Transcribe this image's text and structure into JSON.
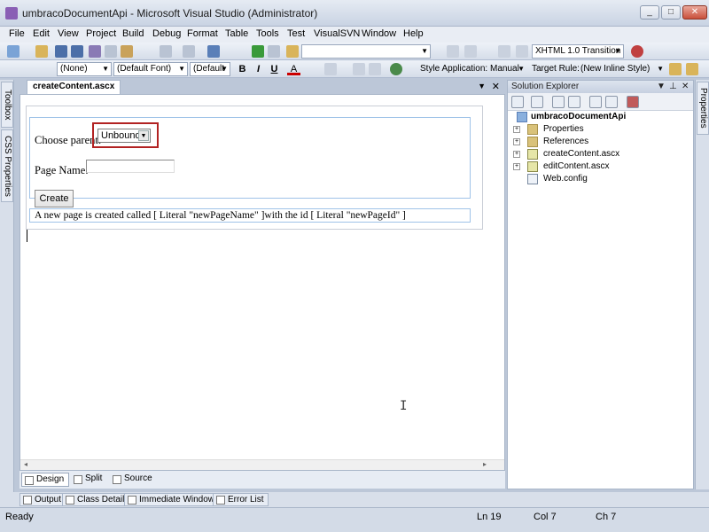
{
  "window": {
    "title": "umbracoDocumentApi - Microsoft Visual Studio (Administrator)"
  },
  "menu": [
    "File",
    "Edit",
    "View",
    "Project",
    "Build",
    "Debug",
    "Format",
    "Table",
    "Tools",
    "Test",
    "VisualSVN",
    "Window",
    "Help"
  ],
  "toolbar1": {
    "doctype": "XHTML 1.0 Transition"
  },
  "toolbar2": {
    "block_format": "(None)",
    "font": "(Default Font)",
    "size": "(Default",
    "bold": "B",
    "italic": "I",
    "underline": "U",
    "font_color": "A",
    "style_application_label": "Style Application:",
    "style_application_value": "Manual",
    "target_rule_label": "Target Rule:",
    "target_rule_value": "(New Inline Style)"
  },
  "left_strip": {
    "toolbox": "Toolbox",
    "css_properties": "CSS Properties"
  },
  "document": {
    "tab": "createContent.ascx",
    "choose_parent_label": "Choose parent:",
    "parent_select_value": "Unbound",
    "page_name_label": "Page Name:",
    "create_button": "Create",
    "result_text": "A new page is created called [ Literal \"newPageName\" ]with the id [ Literal \"newPageId\" ]"
  },
  "views": {
    "design": "Design",
    "split": "Split",
    "source": "Source"
  },
  "bottom_tabs": [
    "Output",
    "Class Details",
    "Immediate Window",
    "Error List"
  ],
  "status": {
    "text": "Ready",
    "line": "Ln 19",
    "col": "Col 7",
    "ch": "Ch 7"
  },
  "solution_explorer": {
    "title": "Solution Explorer",
    "project": "umbracoDocumentApi",
    "items": [
      "Properties",
      "References",
      "createContent.ascx",
      "editContent.ascx",
      "Web.config"
    ]
  },
  "right_strip": {
    "properties": "Properties"
  },
  "colors": {
    "highlight_box": "#b22222",
    "panel_border": "#a9b6c9"
  }
}
